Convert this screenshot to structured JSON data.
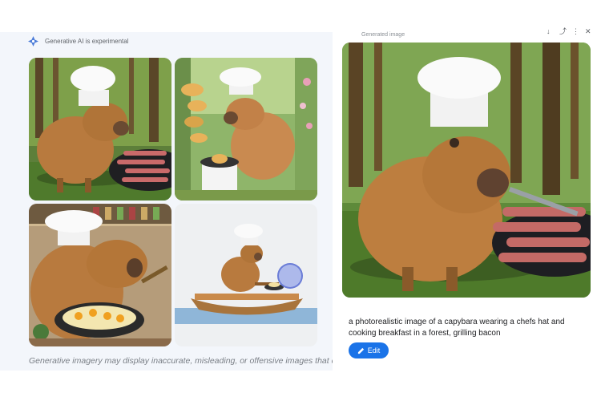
{
  "header": {
    "experimental_label": "Generative AI is experimental"
  },
  "left": {
    "disclaimer": "Generative imagery may display inaccurate, misleading, or offensive images that do"
  },
  "right": {
    "generated_label": "Generated image",
    "prompt": "a photorealistic image of a capybara wearing a chefs hat and cooking breakfast in a forest, grilling bacon",
    "edit_label": "Edit"
  },
  "icons": [
    "sparkle-icon",
    "pencil-icon"
  ],
  "colors": {
    "accent": "#1a73e8",
    "forest": "#3f6b2a",
    "capybara": "#b87a3e"
  }
}
